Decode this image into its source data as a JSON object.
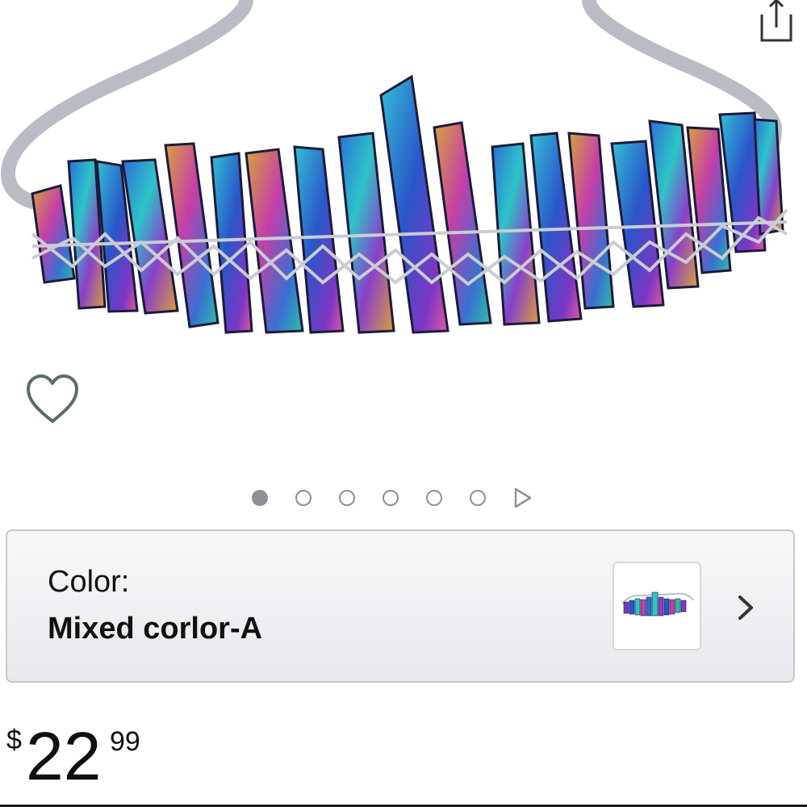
{
  "product": {
    "image_icon": "rainbow-crystal-crown-headband"
  },
  "actions": {
    "share_icon": "share-icon",
    "wishlist_icon": "heart-outline-icon"
  },
  "carousel": {
    "total_dots": 6,
    "active_index": 0,
    "next_icon": "play-triangle-icon"
  },
  "variation": {
    "label": "Color:",
    "value": "Mixed corlor-A",
    "chevron_icon": "chevron-right-icon"
  },
  "price": {
    "symbol": "$",
    "whole": "22",
    "fraction": "99"
  },
  "colors": {
    "text": "#0f1111",
    "dot": "#8d9096",
    "border": "#c4c8cc"
  }
}
